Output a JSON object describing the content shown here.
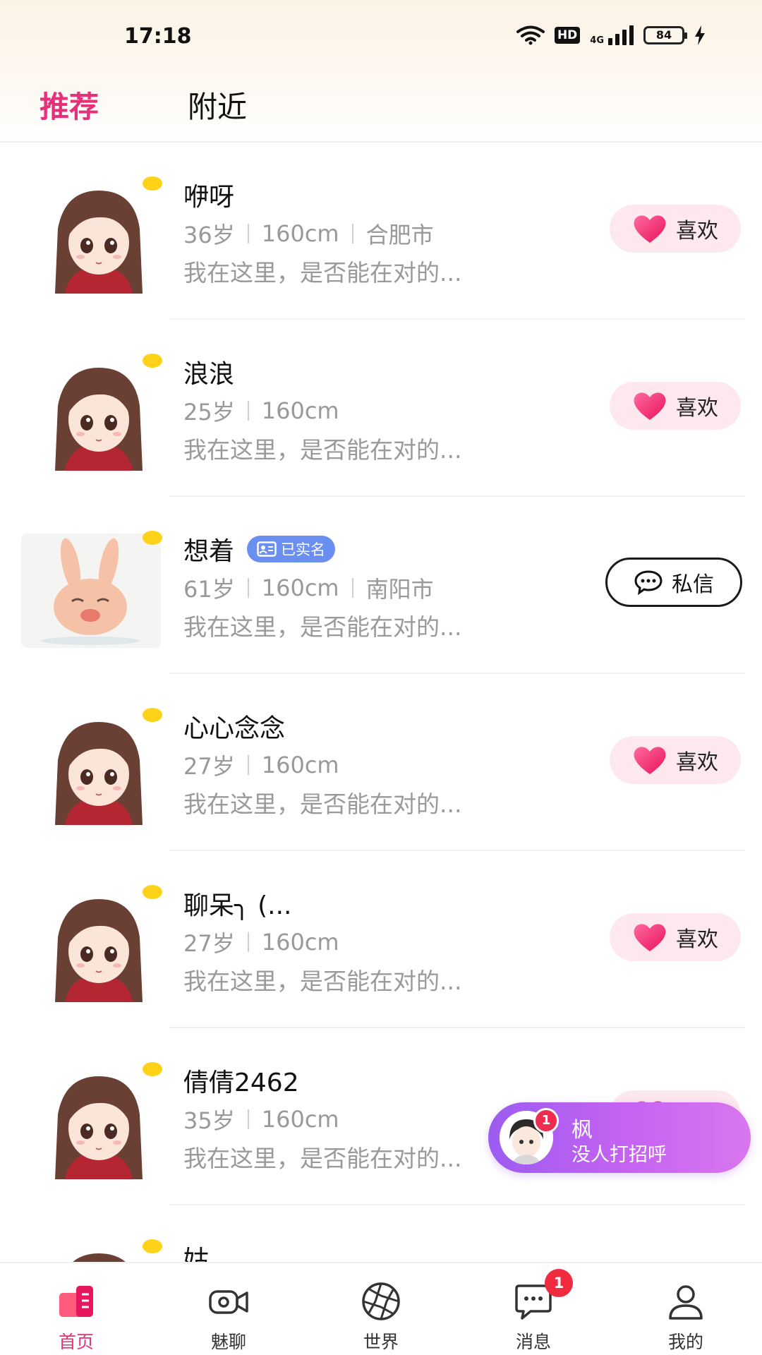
{
  "status_bar": {
    "time": "17:18",
    "hd": "HD",
    "network": "4G",
    "battery": "84"
  },
  "tabs": [
    {
      "label": "推荐",
      "active": true
    },
    {
      "label": "附近",
      "active": false
    }
  ],
  "users": [
    {
      "name": "咿呀",
      "age": "36岁",
      "height": "160cm",
      "city": "合肥市",
      "desc": "我在这里，是否能在对的...",
      "action": "like",
      "action_label": "喜欢",
      "verified": false,
      "avatar": "girl-avatar"
    },
    {
      "name": "浪浪",
      "age": "25岁",
      "height": "160cm",
      "city": "",
      "desc": "我在这里，是否能在对的...",
      "action": "like",
      "action_label": "喜欢",
      "verified": false,
      "avatar": "girl-avatar"
    },
    {
      "name": "想着",
      "age": "61岁",
      "height": "160cm",
      "city": "南阳市",
      "desc": "我在这里，是否能在对的...",
      "action": "message",
      "action_label": "私信",
      "verified": true,
      "verified_label": "已实名",
      "avatar": "rabbit-avatar"
    },
    {
      "name": "心心念念",
      "age": "27岁",
      "height": "160cm",
      "city": "",
      "desc": "我在这里，是否能在对的...",
      "action": "like",
      "action_label": "喜欢",
      "verified": false,
      "avatar": "girl-avatar"
    },
    {
      "name": "聊呆╮  (...",
      "age": "27岁",
      "height": "160cm",
      "city": "",
      "desc": "我在这里，是否能在对的...",
      "action": "like",
      "action_label": "喜欢",
      "verified": false,
      "avatar": "girl-avatar"
    },
    {
      "name": "倩倩2462",
      "age": "35岁",
      "height": "160cm",
      "city": "",
      "desc": "我在这里，是否能在对的...",
      "action": "like",
      "action_label": "喜欢",
      "verified": false,
      "avatar": "girl-avatar"
    },
    {
      "name": "姑",
      "age": "",
      "height": "",
      "city": "",
      "desc": "",
      "action": "none",
      "action_label": "",
      "verified": false,
      "avatar": "girl-avatar"
    }
  ],
  "popup": {
    "name": "枫",
    "text": "没人打招呼",
    "badge": "1"
  },
  "nav": [
    {
      "label": "首页",
      "icon": "home-icon",
      "active": true,
      "badge": ""
    },
    {
      "label": "魅聊",
      "icon": "video-camera-icon",
      "active": false,
      "badge": ""
    },
    {
      "label": "世界",
      "icon": "aperture-icon",
      "active": false,
      "badge": ""
    },
    {
      "label": "消息",
      "icon": "chat-bubble-icon",
      "active": false,
      "badge": "1"
    },
    {
      "label": "我的",
      "icon": "user-icon",
      "active": false,
      "badge": ""
    }
  ],
  "colors": {
    "accent": "#e6317a",
    "online_dot": "#ffd21a",
    "like_bg": "#fde8ee",
    "verified_bg": "#6b8ff0",
    "popup_from": "#9b5cf0",
    "popup_to": "#d977ee",
    "badge_red": "#f02a3f"
  }
}
